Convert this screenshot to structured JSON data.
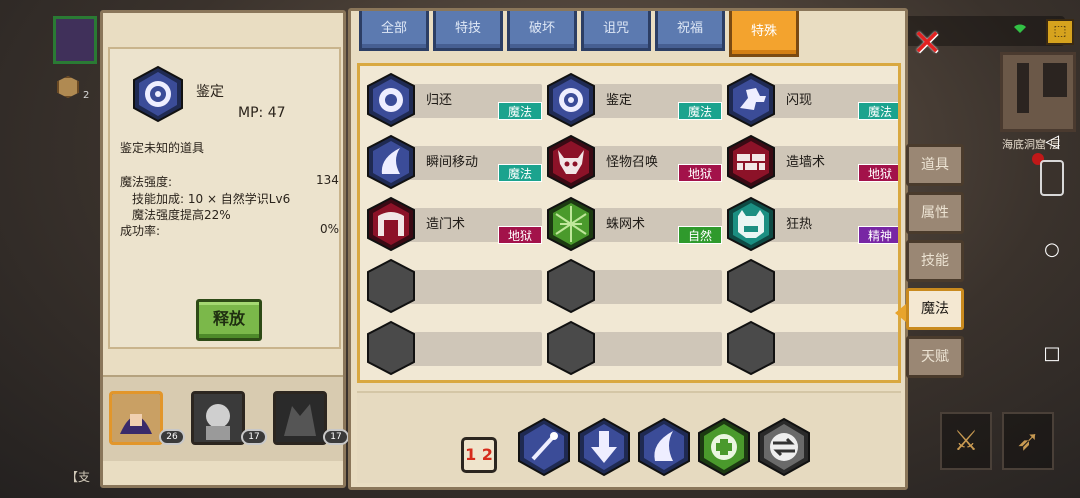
{
  "hud": {
    "player_level": "2",
    "zone_name": "海底洞窟 层",
    "bottom_text": "【支"
  },
  "detail": {
    "spell_name": "鉴定",
    "mp": "MP: 47",
    "description": "鉴定未知的道具",
    "power_label": "魔法强度:",
    "power_value": "134",
    "bonus_line": "技能加成: 10 × 自然学识Lv6",
    "boost_line": "魔法强度提高22%",
    "success_label": "成功率:",
    "success_value": "0%",
    "release_label": "释放"
  },
  "party": [
    {
      "level": "26"
    },
    {
      "level": "17"
    },
    {
      "level": "17"
    }
  ],
  "tabs": [
    {
      "label": "全部",
      "active": false
    },
    {
      "label": "特技",
      "active": false
    },
    {
      "label": "破坏",
      "active": false
    },
    {
      "label": "诅咒",
      "active": false
    },
    {
      "label": "祝福",
      "active": false
    },
    {
      "label": "特殊",
      "active": true
    }
  ],
  "spells": [
    {
      "name": "归还",
      "category": "魔法",
      "icon": "return-ring-icon"
    },
    {
      "name": "鉴定",
      "category": "魔法",
      "icon": "identify-eye-icon"
    },
    {
      "name": "闪现",
      "category": "魔法",
      "icon": "blink-runner-icon"
    },
    {
      "name": "瞬间移动",
      "category": "魔法",
      "icon": "teleport-swirl-icon"
    },
    {
      "name": "怪物召唤",
      "category": "地狱",
      "icon": "demon-skull-icon"
    },
    {
      "name": "造墙术",
      "category": "地狱",
      "icon": "brick-wall-icon"
    },
    {
      "name": "造门术",
      "category": "地狱",
      "icon": "stone-gate-icon"
    },
    {
      "name": "蛛网术",
      "category": "自然",
      "icon": "spider-web-icon"
    },
    {
      "name": "狂热",
      "category": "精神",
      "icon": "bear-roar-icon"
    }
  ],
  "quickbar": {
    "swap_label": "1 2",
    "slots": [
      "magic-wand-icon",
      "down-arrow-icon",
      "flame-swirl-icon",
      "heal-plus-icon",
      "swap-arrows-icon"
    ]
  },
  "side_menu": [
    {
      "label": "道具",
      "active": false
    },
    {
      "label": "属性",
      "active": false
    },
    {
      "label": "技能",
      "active": false
    },
    {
      "label": "魔法",
      "active": true
    },
    {
      "label": "天赋",
      "active": false
    }
  ],
  "colors": {
    "magic": "#1ba38e",
    "hell": "#a3124a",
    "nature": "#2f9a2c",
    "spirit": "#7826a4",
    "active_tab": "#f3a32e",
    "tab": "#5c7ab0"
  }
}
